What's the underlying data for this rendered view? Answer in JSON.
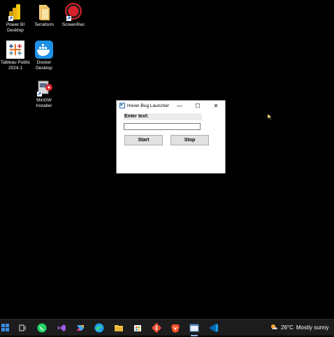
{
  "desktop": {
    "icons": [
      {
        "label": "Power BI Desktop",
        "icon": "power-bi-icon"
      },
      {
        "label": "Terraform",
        "icon": "folder-icon"
      },
      {
        "label": "ScreenRec",
        "icon": "screenrec-icon"
      },
      {
        "label": "Tableau Public 2024.1",
        "icon": "tableau-icon"
      },
      {
        "label": "Docker Desktop",
        "icon": "docker-icon"
      },
      {
        "label": "MinGW Installer",
        "icon": "installer-icon"
      }
    ]
  },
  "window": {
    "title": "Hover-Bug Launcher",
    "minimize_glyph": "—",
    "maximize_glyph": "☐",
    "close_glyph": "✕",
    "enter_label": "Enter text:",
    "input_value": "",
    "start_label": "Start",
    "stop_label": "Stop"
  },
  "taskbar": {
    "items": [
      "start-icon",
      "task-view-icon",
      "whatsapp-icon",
      "visual-studio-icon",
      "copilot-icon",
      "edge-icon",
      "file-explorer-icon",
      "store-icon",
      "git-icon",
      "brave-icon",
      "app-window-icon",
      "vscode-icon"
    ],
    "weather_temp": "26°C",
    "weather_desc": "Mostly sunny"
  },
  "colors": {
    "desktop_bg": "#000000",
    "taskbar_bg": "#1c1c1c",
    "window_bg": "#ffffff",
    "button_bg": "#e1e1e1"
  }
}
